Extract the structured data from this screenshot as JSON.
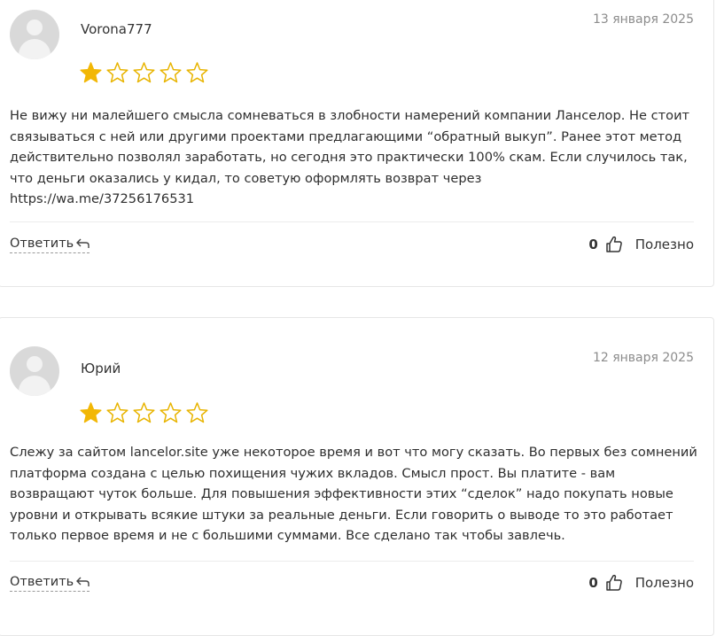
{
  "reviews": [
    {
      "author": "Vorona777",
      "date": "13 января 2025",
      "rating": 1,
      "rating_max": 5,
      "text": "Не вижу ни малейшего смысла сомневаться в злобности намерений компании Ланселор. Не стоит связываться с ней или другими проектами предлагающими “обратный выкуп”. Ранее этот метод действительно позволял заработать, но сегодня это практически 100% скам. Если случилось так, что деньги оказались у кидал, то советую оформлять возврат через",
      "link": "https://wa.me/37256176531",
      "reply_label": "Ответить",
      "likes": "0",
      "useful_label": "Полезно"
    },
    {
      "author": "Юрий",
      "date": "12 января 2025",
      "rating": 1,
      "rating_max": 5,
      "text": "Слежу за сайтом lancelor.site уже некоторое время и вот что могу сказать. Во первых без сомнений платформа создана с целью похищения чужих вкладов. Смысл прост. Вы платите - вам возвращают чуток больше. Для повышения эффективности этих “сделок” надо покупать новые уровни и открывать всякие штуки за реальные деньги. Если говорить о выводе то это работает только первое время и не с большими суммами. Все сделано так чтобы завлечь.",
      "reply_label": "Ответить",
      "likes": "0",
      "useful_label": "Полезно"
    }
  ],
  "colors": {
    "star_filled": "#f2b705",
    "star_outline": "#e8b400",
    "avatar_bg": "#d9d9d9",
    "date_text": "#8c8c8c"
  },
  "icons": {
    "reply": "reply-arrow-icon",
    "like": "thumbs-up-icon",
    "avatar": "user-placeholder-icon",
    "star": "star-icon"
  }
}
